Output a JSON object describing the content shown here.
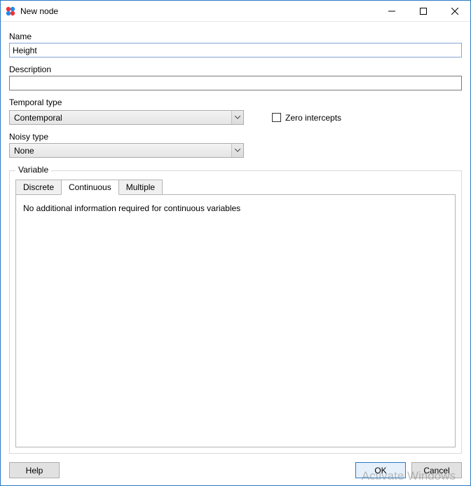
{
  "window": {
    "title": "New node"
  },
  "fields": {
    "name_label": "Name",
    "name_value": "Height",
    "description_label": "Description",
    "description_value": "",
    "temporal_label": "Temporal type",
    "temporal_value": "Contemporal",
    "noisy_label": "Noisy type",
    "noisy_value": "None",
    "zero_intercepts_label": "Zero intercepts"
  },
  "variable": {
    "legend": "Variable",
    "tabs": {
      "discrete": "Discrete",
      "continuous": "Continuous",
      "multiple": "Multiple"
    },
    "continuous_body": "No additional information required for continuous variables"
  },
  "buttons": {
    "help": "Help",
    "ok": "OK",
    "cancel": "Cancel"
  },
  "watermark": "Activate Windows"
}
